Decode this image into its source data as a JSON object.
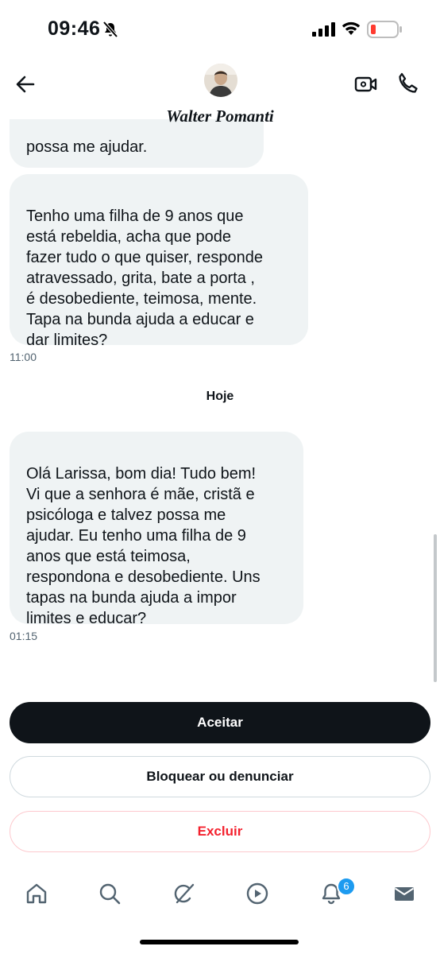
{
  "status_bar": {
    "time": "09:46",
    "battery_color": "#ff3b30"
  },
  "header": {
    "contact_name": "Walter Pomanti",
    "icons": [
      "back-arrow-icon",
      "video-camera-icon",
      "phone-icon"
    ]
  },
  "messages": [
    {
      "text": "possa me ajudar."
    },
    {
      "text": "Tenho uma filha  de 9 anos que\nestá rebeldia, acha que pode\nfazer tudo o que quiser,  responde\natravessado, grita, bate a porta ,\n é desobediente, teimosa, mente.\nTapa  na bunda ajuda a educar e\ndar limites?",
      "time": "11:00"
    },
    {
      "text": "Olá Larissa, bom dia! Tudo bem!\nVi que a senhora é mãe, cristã e\npsicóloga e talvez possa me\najudar. Eu tenho uma filha de 9\nanos que está teimosa,\nrespondona e desobediente. Uns\ntapas na bunda ajuda a impor\nlimites e educar?",
      "time": "01:15"
    }
  ],
  "day_separator": "Hoje",
  "actions": {
    "accept": "Aceitar",
    "block": "Bloquear ou denunciar",
    "delete": "Excluir"
  },
  "tab_bar": {
    "icons": [
      "home-icon",
      "search-icon",
      "grok-icon",
      "video-icon",
      "notifications-icon",
      "messages-icon"
    ],
    "notification_count": "6",
    "accent_color": "#1d9bf0"
  }
}
